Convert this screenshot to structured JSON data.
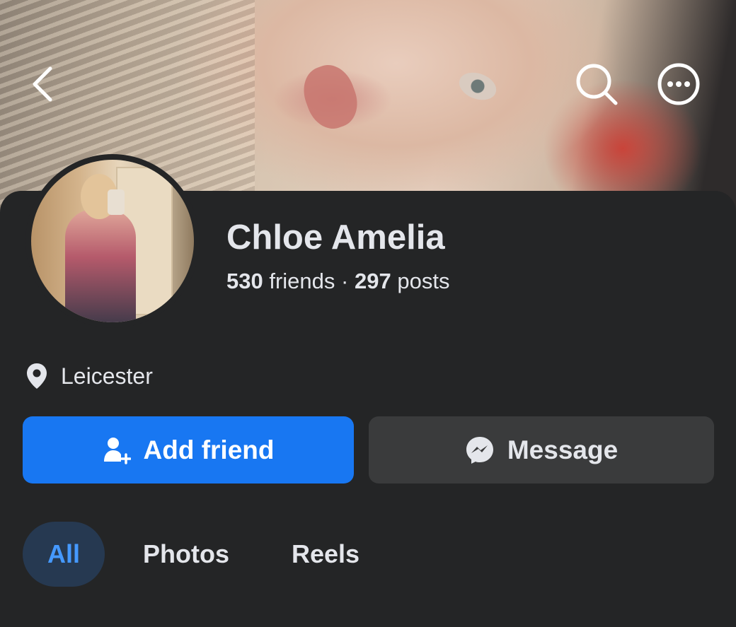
{
  "profile": {
    "name": "Chloe Amelia",
    "friends_count": "530",
    "friends_label": "friends",
    "separator": "·",
    "posts_count": "297",
    "posts_label": "posts",
    "location": "Leicester"
  },
  "actions": {
    "add_friend_label": "Add friend",
    "message_label": "Message"
  },
  "tabs": [
    {
      "label": "All",
      "selected": true
    },
    {
      "label": "Photos",
      "selected": false
    },
    {
      "label": "Reels",
      "selected": false
    }
  ],
  "icons": {
    "back": "chevron-left-icon",
    "search": "search-icon",
    "more": "more-options-icon",
    "location": "location-pin-icon",
    "add_friend": "add-person-icon",
    "message": "messenger-icon"
  },
  "colors": {
    "background": "#242526",
    "primary_button": "#1877f2",
    "secondary_button": "#3a3b3c",
    "selected_tab_bg": "#263951",
    "selected_tab_text": "#4599ff",
    "text": "#e4e6eb"
  }
}
